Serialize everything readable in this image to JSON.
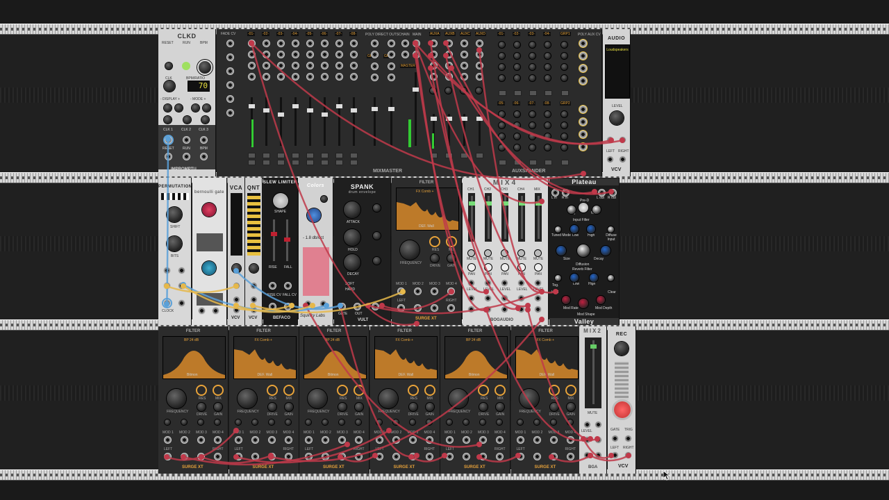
{
  "modules": {
    "clkd": {
      "title": "CLKD",
      "reset": "RESET",
      "run": "RUN",
      "bpm": "BPM",
      "clk": "CLK",
      "bpm_ratio": "BPM/RATIO",
      "value": "70",
      "display": "- DISPLAY +",
      "mode": "- MODE +",
      "clk1": "CLK 1",
      "clk2": "CLK 2",
      "clk3": "CLK 3",
      "brand": "IMPROMPTU"
    },
    "mixmaster": {
      "fade_cv": "FADE CV",
      "channels": [
        "-01-",
        "-02-",
        "-03-",
        "-04-",
        "-05-",
        "-06-",
        "-07-",
        "-08-"
      ],
      "poly_direct_outs": "POLY DIRECT OUTS",
      "chain": "CHAIN",
      "main": "MAIN",
      "grp1": "GRP1",
      "grp2": "GRP2",
      "master": "MASTER",
      "brand": "MIXMASTER",
      "mute": "M",
      "solo": "S"
    },
    "auxspander": {
      "aux": [
        "AUXA",
        "AUXB",
        "AUXC",
        "AUXD"
      ],
      "channels": [
        "-01-",
        "-02-",
        "-03-",
        "-04-",
        "GRP1"
      ],
      "channels2": [
        "-05-",
        "-06-",
        "-07-",
        "-08-",
        "GRP2"
      ],
      "poly_aux_cv": "POLY AUX CV",
      "brand": "AUXSPANDER"
    },
    "audio": {
      "title": "AUDIO",
      "device": "Loudspeakers",
      "level": "LEVEL",
      "left": "LEFT",
      "right": "RIGHT",
      "brand": "VCV"
    },
    "permutation": {
      "title": "PERMUTATION",
      "shift": "SHIFT",
      "bits": "BITS",
      "clock": "CLOCK"
    },
    "bernoulli": {
      "title": "bernoulli gate"
    },
    "vca": {
      "title": "VCA",
      "brand": "VCV"
    },
    "qnt": {
      "title": "QNT",
      "brand": "VCV"
    },
    "slew": {
      "title": "SLEW LIMITER",
      "shape": "SHAPE",
      "rise": "RISE",
      "fall": "FALL",
      "rise_cv": "RISE CV",
      "fall_cv": "FALL CV",
      "brand": "BEFACO"
    },
    "colors": {
      "title": "Colors",
      "slope": "- 1.8 db/oct",
      "brand": "Squinky Labs"
    },
    "spank": {
      "title": "SPANK",
      "subtitle": "drum envelope",
      "attack": "ATTACK",
      "hold": "HOLD",
      "decay": "DECAY",
      "soft": "SOFT",
      "hard": "HARD",
      "gate": "GATE",
      "out": "OUT",
      "brand": "VULT"
    },
    "filter_main": {
      "title": "FILTER",
      "display_label": "FX Comb +",
      "sub": "DEF. Wall",
      "frequency": "FREQUENCY",
      "res": "RES",
      "mix": "MIX",
      "drive": "DRIVE",
      "gain": "GAIN",
      "mods": [
        "MOD 1",
        "MOD 2",
        "MOD 3",
        "MOD 4"
      ],
      "left": "LEFT",
      "right": "RIGHT",
      "brand": "SURGE XT"
    },
    "mix4": {
      "title": "MIX4",
      "channels": [
        "CH1",
        "CH2",
        "CH3",
        "CH4",
        "MIX"
      ],
      "mute": "MUTE",
      "pan": "PAN",
      "level": "LEVEL",
      "brand": "BOGAUDIO"
    },
    "plateau": {
      "title": "Plateau",
      "l_in": "L in",
      "r_in": "R in",
      "l_out": "L out",
      "r_out": "R out",
      "predelay": "Pre-D",
      "dry": "Dry",
      "wet": "Wet",
      "input_filter": "Input Filter",
      "low": "Low",
      "high": "High",
      "diffuse_input": "Diffuse Input",
      "tuned_mode": "Tuned Mode",
      "size": "Size",
      "decay": "Decay",
      "diffusion": "Diffusion",
      "reverb_filter": "Reverb Filter",
      "tog": "Tog.",
      "hold": "Hold",
      "clear": "Clear",
      "mod_rate": "Mod Rate",
      "mod_shape": "Mod Shape",
      "mod_depth": "Mod Depth",
      "brand": "Valley"
    },
    "mix2": {
      "title": "MIX2",
      "mute": "MUTE",
      "level": "LEVEL",
      "brand": "BGA"
    },
    "rec": {
      "title": "REC",
      "gate": "GATE",
      "trig": "TRIG",
      "left": "LEFT",
      "right": "RIGHT",
      "brand": "VCV"
    },
    "filters_bottom": [
      {
        "title": "FILTER",
        "display_label": "BP 24 dB",
        "sub": "Bitmon",
        "brand": "SURGE XT"
      },
      {
        "title": "FILTER",
        "display_label": "FX Comb +",
        "sub": "DEF. Wall",
        "brand": "SURGE XT"
      },
      {
        "title": "FILTER",
        "display_label": "BP 24 dB",
        "sub": "Bitmon",
        "brand": "SURGE XT"
      },
      {
        "title": "FILTER",
        "display_label": "FX Comb +",
        "sub": "DEF. Wall",
        "brand": "SURGE XT"
      },
      {
        "title": "FILTER",
        "display_label": "BP 24 dB",
        "sub": "Bitmon",
        "brand": "SURGE XT"
      },
      {
        "title": "FILTER",
        "display_label": "FX Comb +",
        "sub": "DEF. Wall",
        "brand": "SURGE XT"
      }
    ],
    "filter_labels": {
      "frequency": "FREQUENCY",
      "res": "RES",
      "mix": "MIX",
      "drive": "DRIVE",
      "gain": "GAIN",
      "mods": [
        "MOD 1",
        "MOD 2",
        "MOD 3",
        "MOD 4"
      ],
      "left": "LEFT",
      "right": "RIGHT"
    }
  },
  "colors": {
    "cable_red": "#c0394a",
    "cable_yellow": "#e6b84a",
    "cable_blue": "#5aa0d8",
    "surge_orange": "#e8a33a"
  }
}
